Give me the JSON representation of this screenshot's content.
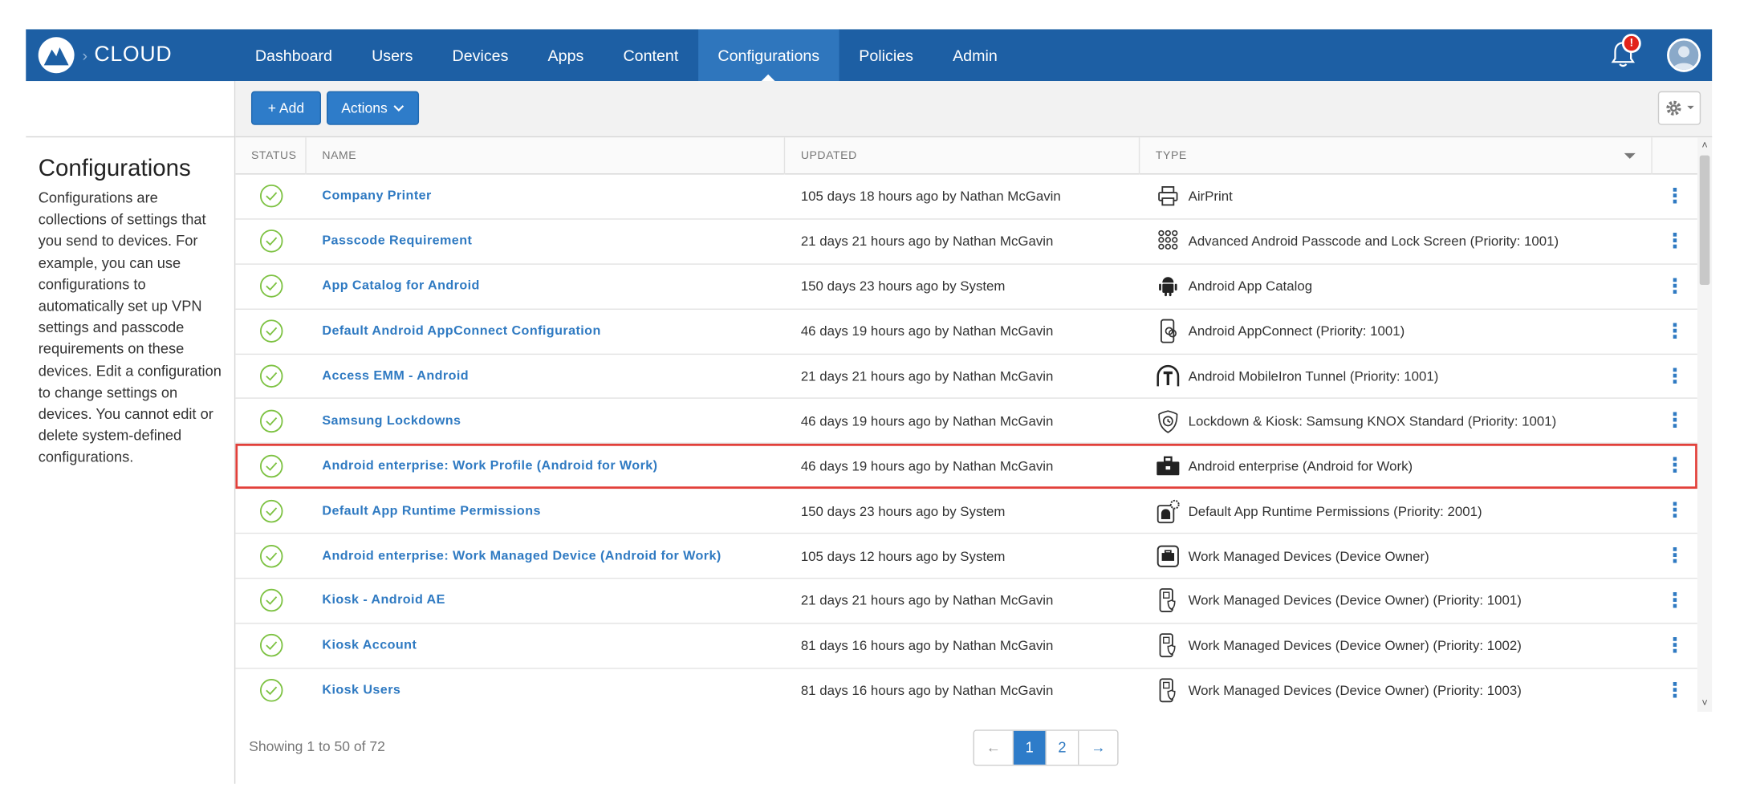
{
  "brand": {
    "name": "CLOUD"
  },
  "nav": {
    "items": [
      "Dashboard",
      "Users",
      "Devices",
      "Apps",
      "Content",
      "Configurations",
      "Policies",
      "Admin"
    ],
    "active": "Configurations",
    "notification_badge": "!"
  },
  "sidebar": {
    "title": "Configurations",
    "description": "Configurations are collections of settings that you send to devices. For example, you can use configurations to automatically set up VPN settings and passcode requirements on these devices. Edit a configuration to change settings on devices. You cannot edit or delete system-defined configurations."
  },
  "toolbar": {
    "add_label": "+ Add",
    "actions_label": "Actions"
  },
  "table": {
    "headers": {
      "status": "STATUS",
      "name": "NAME",
      "updated": "UPDATED",
      "type": "TYPE"
    },
    "rows": [
      {
        "name": "Company Printer",
        "updated": "105 days 18 hours ago by Nathan McGavin",
        "type": "AirPrint",
        "icon": "printer-icon"
      },
      {
        "name": "Passcode Requirement",
        "updated": "21 days 21 hours ago by Nathan McGavin",
        "type": "Advanced Android Passcode and Lock Screen (Priority: 1001)",
        "icon": "keypad-icon"
      },
      {
        "name": "App Catalog for Android",
        "updated": "150 days 23 hours ago by System",
        "type": "Android App Catalog",
        "icon": "android-icon"
      },
      {
        "name": "Default Android AppConnect Configuration",
        "updated": "46 days 19 hours ago by Nathan McGavin",
        "type": "Android AppConnect (Priority: 1001)",
        "icon": "phone-link-icon"
      },
      {
        "name": "Access EMM - Android",
        "updated": "21 days 21 hours ago by Nathan McGavin",
        "type": "Android MobileIron Tunnel (Priority: 1001)",
        "icon": "tunnel-icon"
      },
      {
        "name": "Samsung Lockdowns",
        "updated": "46 days 19 hours ago by Nathan McGavin",
        "type": "Lockdown & Kiosk: Samsung KNOX Standard (Priority: 1001)",
        "icon": "knox-shield-icon"
      },
      {
        "name": "Android enterprise: Work Profile (Android for Work)",
        "updated": "46 days 19 hours ago by Nathan McGavin",
        "type": "Android enterprise (Android for Work)",
        "icon": "briefcase-icon",
        "highlighted": true
      },
      {
        "name": "Default App Runtime Permissions",
        "updated": "150 days 23 hours ago by System",
        "type": "Default App Runtime Permissions (Priority: 2001)",
        "icon": "android-gear-icon"
      },
      {
        "name": "Android enterprise: Work Managed Device (Android for Work)",
        "updated": "105 days 12 hours ago by System",
        "type": "Work Managed Devices (Device Owner)",
        "icon": "work-device-icon"
      },
      {
        "name": "Kiosk - Android AE",
        "updated": "21 days 21 hours ago by Nathan McGavin",
        "type": "Work Managed Devices (Device Owner) (Priority: 1001)",
        "icon": "phone-shield-icon"
      },
      {
        "name": "Kiosk Account",
        "updated": "81 days 16 hours ago by Nathan McGavin",
        "type": "Work Managed Devices (Device Owner) (Priority: 1002)",
        "icon": "phone-shield-icon"
      },
      {
        "name": "Kiosk Users",
        "updated": "81 days 16 hours ago by Nathan McGavin",
        "type": "Work Managed Devices (Device Owner) (Priority: 1003)",
        "icon": "phone-shield-icon"
      }
    ]
  },
  "footer": {
    "showing": "Showing 1 to 50 of 72",
    "pages": [
      "1",
      "2"
    ],
    "current_page": "1",
    "prev": "←",
    "next": "→"
  },
  "colors": {
    "nav_bg": "#1d5fa4",
    "accent": "#2e7cc9",
    "status_ok": "#7dc242",
    "highlight_border": "#e2403a"
  }
}
